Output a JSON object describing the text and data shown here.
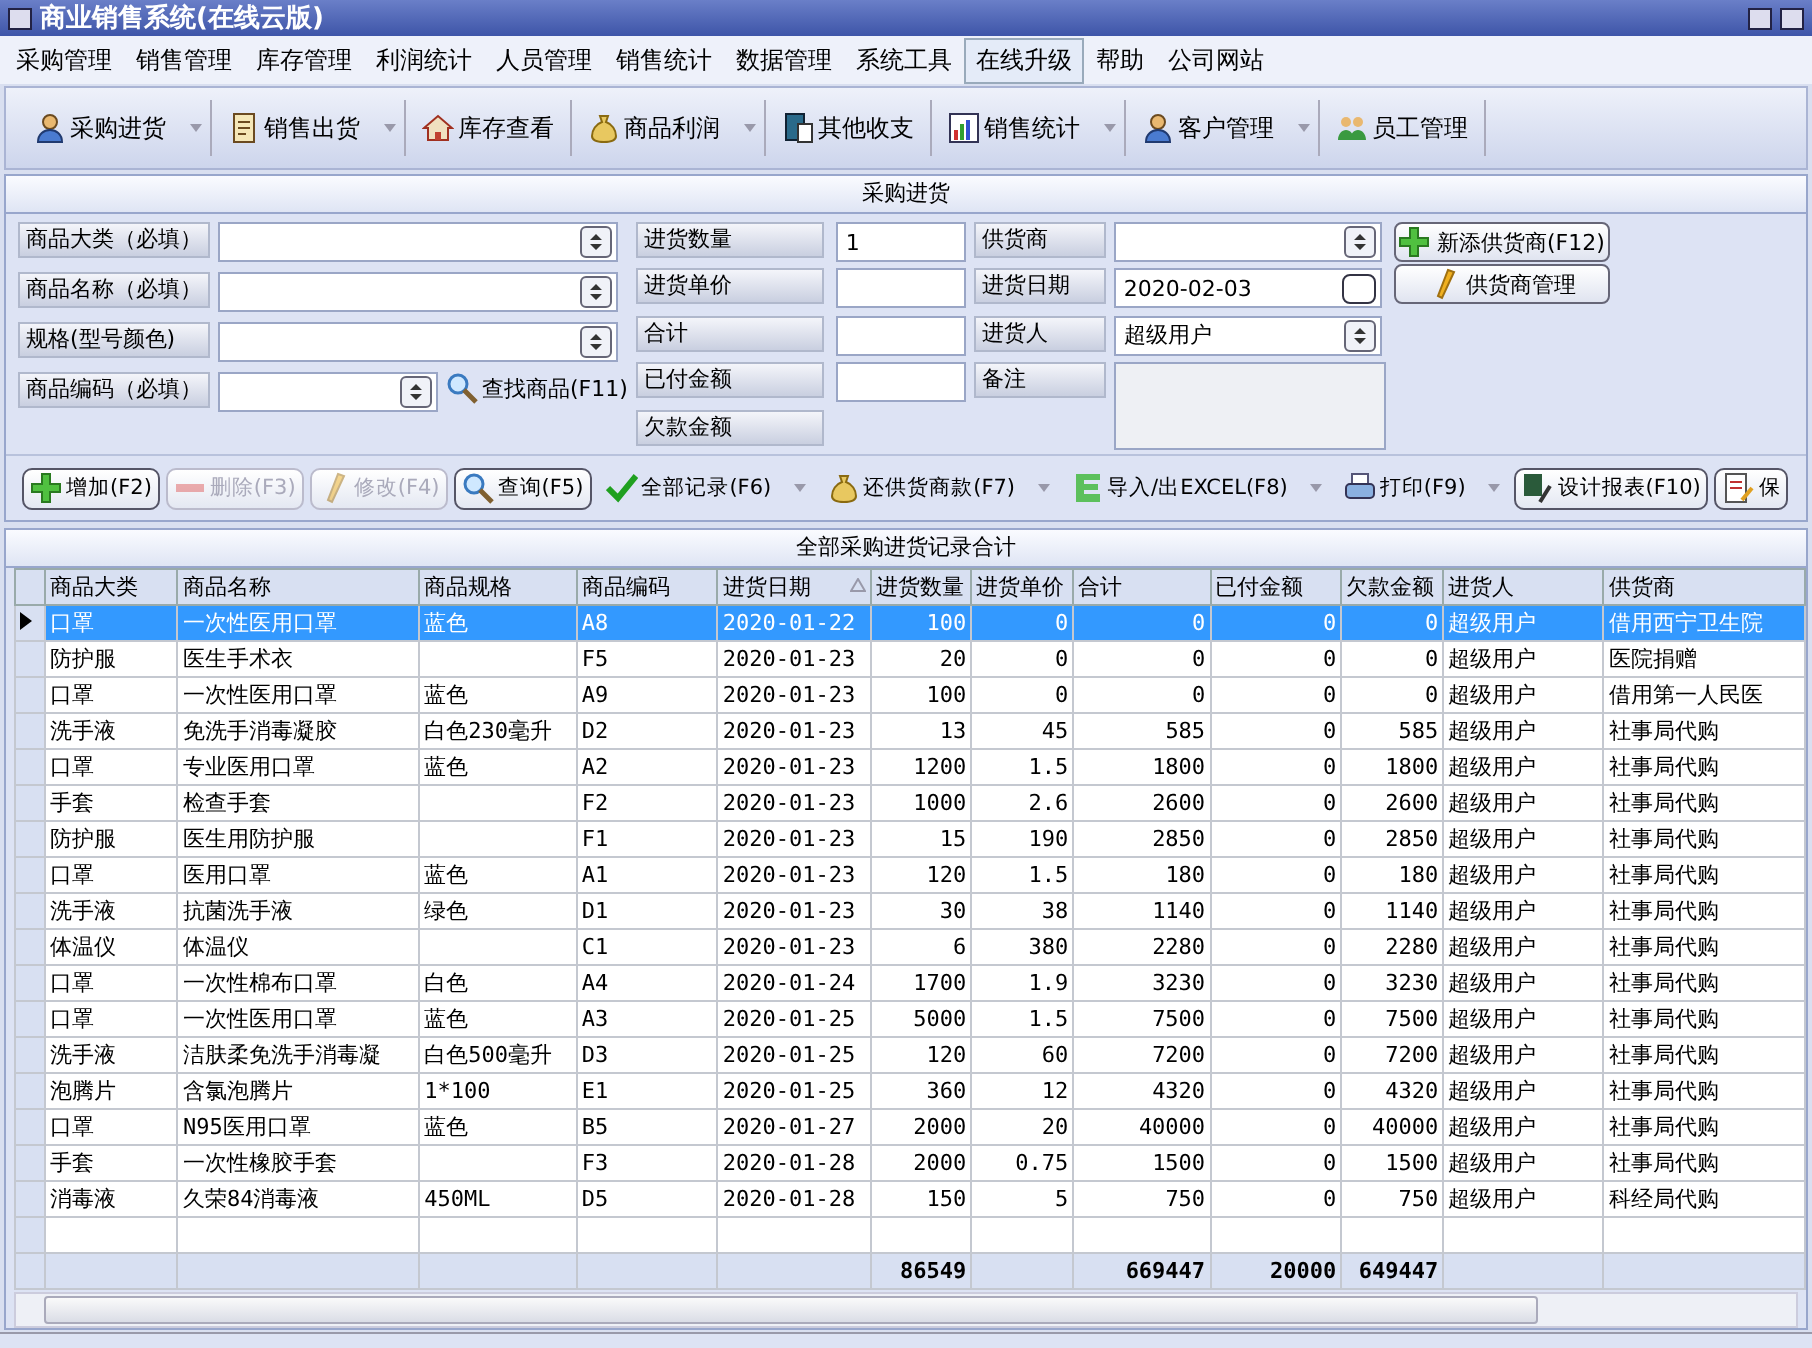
{
  "window": {
    "title": "商业销售系统(在线云版)"
  },
  "menu": [
    {
      "label": "采购管理",
      "selected": false
    },
    {
      "label": "销售管理",
      "selected": false
    },
    {
      "label": "库存管理",
      "selected": false
    },
    {
      "label": "利润统计",
      "selected": false
    },
    {
      "label": "人员管理",
      "selected": false
    },
    {
      "label": "销售统计",
      "selected": false
    },
    {
      "label": "数据管理",
      "selected": false
    },
    {
      "label": "系统工具",
      "selected": false
    },
    {
      "label": "在线升级",
      "selected": true
    },
    {
      "label": "帮助",
      "selected": false
    },
    {
      "label": "公司网站",
      "selected": false
    }
  ],
  "toolbar": [
    {
      "label": "采购进货",
      "kind": "person",
      "dropdown": true
    },
    {
      "label": "销售出货",
      "kind": "doc",
      "dropdown": true
    },
    {
      "label": "库存查看",
      "kind": "house",
      "dropdown": false
    },
    {
      "label": "商品利润",
      "kind": "money",
      "dropdown": true
    },
    {
      "label": "其他收支",
      "kind": "phone",
      "dropdown": false
    },
    {
      "label": "销售统计",
      "kind": "chart",
      "dropdown": true
    },
    {
      "label": "客户管理",
      "kind": "person",
      "dropdown": true
    },
    {
      "label": "员工管理",
      "kind": "people",
      "dropdown": false
    }
  ],
  "form": {
    "title": "采购进货",
    "goods_fields": [
      {
        "label": "商品大类（必填）"
      },
      {
        "label": "商品名称（必填）"
      },
      {
        "label": "规格(型号颜色)"
      },
      {
        "label": "商品编码（必填）"
      }
    ],
    "find_goods": "查找商品(F11)",
    "amount_fields": [
      {
        "label": "进货数量",
        "value": "1",
        "kind": "input"
      },
      {
        "label": "进货单价",
        "kind": "input"
      },
      {
        "label": "合计",
        "kind": "input"
      },
      {
        "label": "已付金额",
        "kind": "input"
      },
      {
        "label": "欠款金额",
        "kind": "label"
      }
    ],
    "supplier_fields": [
      {
        "label": "供货商",
        "kind": "combo"
      },
      {
        "label": "进货日期",
        "value": "2020-02-03",
        "kind": "date"
      },
      {
        "label": "进货人",
        "value": "超级用户",
        "kind": "combo"
      },
      {
        "label": "备注",
        "kind": "memo"
      }
    ],
    "side_buttons": [
      {
        "label": "新添供货商(F12)",
        "kind": "add"
      },
      {
        "label": "供货商管理",
        "kind": "edit"
      }
    ]
  },
  "actions": [
    {
      "label": "增加(F2)",
      "kind": "add",
      "disabled": false,
      "dropdown": false
    },
    {
      "label": "删除(F3)",
      "kind": "delete",
      "disabled": true,
      "dropdown": false
    },
    {
      "label": "修改(F4)",
      "kind": "edit",
      "disabled": true,
      "dropdown": false
    },
    {
      "label": "查询(F5)",
      "kind": "search",
      "disabled": false,
      "dropdown": false
    },
    {
      "label": "全部记录(F6)",
      "kind": "check",
      "disabled": false,
      "dropdown": true
    },
    {
      "label": "还供货商款(F7)",
      "kind": "money",
      "disabled": false,
      "dropdown": true
    },
    {
      "label": "导入/出EXCEL(F8)",
      "kind": "excel",
      "disabled": false,
      "dropdown": true
    },
    {
      "label": "打印(F9)",
      "kind": "print",
      "disabled": false,
      "dropdown": true
    },
    {
      "label": "设计报表(F10)",
      "kind": "report",
      "disabled": false,
      "dropdown": false
    },
    {
      "label": "保",
      "kind": "save",
      "disabled": false,
      "dropdown": false
    }
  ],
  "table": {
    "title": "全部采购进货记录合计",
    "columns": [
      {
        "label": "商品大类",
        "kind": "text",
        "sorted": false
      },
      {
        "label": "商品名称",
        "kind": "text",
        "sorted": false
      },
      {
        "label": "商品规格",
        "kind": "text",
        "sorted": false
      },
      {
        "label": "商品编码",
        "kind": "text",
        "sorted": false
      },
      {
        "label": "进货日期",
        "kind": "text",
        "sorted": true
      },
      {
        "label": "进货数量",
        "kind": "number",
        "sorted": false,
        "total": "86549"
      },
      {
        "label": "进货单价",
        "kind": "number",
        "sorted": false
      },
      {
        "label": "合计",
        "kind": "number",
        "sorted": false,
        "total": "669447"
      },
      {
        "label": "已付金额",
        "kind": "number",
        "sorted": false,
        "total": "20000"
      },
      {
        "label": "欠款金额",
        "kind": "number",
        "sorted": false,
        "total": "649447"
      },
      {
        "label": "进货人",
        "kind": "text",
        "sorted": false
      },
      {
        "label": "供货商",
        "kind": "text",
        "sorted": false
      }
    ],
    "rows": [
      {
        "selected": true,
        "cells": [
          "口罩",
          "一次性医用口罩",
          "蓝色",
          "A8",
          "2020-01-22",
          "100",
          "0",
          "0",
          "0",
          "0",
          "超级用户",
          "借用西宁卫生院"
        ]
      },
      {
        "selected": false,
        "cells": [
          "防护服",
          "医生手术衣",
          null,
          "F5",
          "2020-01-23",
          "20",
          "0",
          "0",
          "0",
          "0",
          "超级用户",
          "医院捐赠"
        ]
      },
      {
        "selected": false,
        "cells": [
          "口罩",
          "一次性医用口罩",
          "蓝色",
          "A9",
          "2020-01-23",
          "100",
          "0",
          "0",
          "0",
          "0",
          "超级用户",
          "借用第一人民医"
        ]
      },
      {
        "selected": false,
        "cells": [
          "洗手液",
          "免洗手消毒凝胶",
          "白色230毫升",
          "D2",
          "2020-01-23",
          "13",
          "45",
          "585",
          "0",
          "585",
          "超级用户",
          "社事局代购"
        ]
      },
      {
        "selected": false,
        "cells": [
          "口罩",
          "专业医用口罩",
          "蓝色",
          "A2",
          "2020-01-23",
          "1200",
          "1.5",
          "1800",
          "0",
          "1800",
          "超级用户",
          "社事局代购"
        ]
      },
      {
        "selected": false,
        "cells": [
          "手套",
          "检查手套",
          null,
          "F2",
          "2020-01-23",
          "1000",
          "2.6",
          "2600",
          "0",
          "2600",
          "超级用户",
          "社事局代购"
        ]
      },
      {
        "selected": false,
        "cells": [
          "防护服",
          "医生用防护服",
          null,
          "F1",
          "2020-01-23",
          "15",
          "190",
          "2850",
          "0",
          "2850",
          "超级用户",
          "社事局代购"
        ]
      },
      {
        "selected": false,
        "cells": [
          "口罩",
          "医用口罩",
          "蓝色",
          "A1",
          "2020-01-23",
          "120",
          "1.5",
          "180",
          "0",
          "180",
          "超级用户",
          "社事局代购"
        ]
      },
      {
        "selected": false,
        "cells": [
          "洗手液",
          "抗菌洗手液",
          "绿色",
          "D1",
          "2020-01-23",
          "30",
          "38",
          "1140",
          "0",
          "1140",
          "超级用户",
          "社事局代购"
        ]
      },
      {
        "selected": false,
        "cells": [
          "体温仪",
          "体温仪",
          null,
          "C1",
          "2020-01-23",
          "6",
          "380",
          "2280",
          "0",
          "2280",
          "超级用户",
          "社事局代购"
        ]
      },
      {
        "selected": false,
        "cells": [
          "口罩",
          "一次性棉布口罩",
          "白色",
          "A4",
          "2020-01-24",
          "1700",
          "1.9",
          "3230",
          "0",
          "3230",
          "超级用户",
          "社事局代购"
        ]
      },
      {
        "selected": false,
        "cells": [
          "口罩",
          "一次性医用口罩",
          "蓝色",
          "A3",
          "2020-01-25",
          "5000",
          "1.5",
          "7500",
          "0",
          "7500",
          "超级用户",
          "社事局代购"
        ]
      },
      {
        "selected": false,
        "cells": [
          "洗手液",
          "洁肤柔免洗手消毒凝",
          "白色500毫升",
          "D3",
          "2020-01-25",
          "120",
          "60",
          "7200",
          "0",
          "7200",
          "超级用户",
          "社事局代购"
        ]
      },
      {
        "selected": false,
        "cells": [
          "泡腾片",
          "含氯泡腾片",
          "1*100",
          "E1",
          "2020-01-25",
          "360",
          "12",
          "4320",
          "0",
          "4320",
          "超级用户",
          "社事局代购"
        ]
      },
      {
        "selected": false,
        "cells": [
          "口罩",
          "N95医用口罩",
          "蓝色",
          "B5",
          "2020-01-27",
          "2000",
          "20",
          "40000",
          "0",
          "40000",
          "超级用户",
          "社事局代购"
        ]
      },
      {
        "selected": false,
        "cells": [
          "手套",
          "一次性橡胶手套",
          null,
          "F3",
          "2020-01-28",
          "2000",
          "0.75",
          "1500",
          "0",
          "1500",
          "超级用户",
          "社事局代购"
        ]
      },
      {
        "selected": false,
        "cells": [
          "消毒液",
          "久荣84消毒液",
          "450ML",
          "D5",
          "2020-01-28",
          "150",
          "5",
          "750",
          "0",
          "750",
          "超级用户",
          "科经局代购"
        ]
      }
    ]
  }
}
